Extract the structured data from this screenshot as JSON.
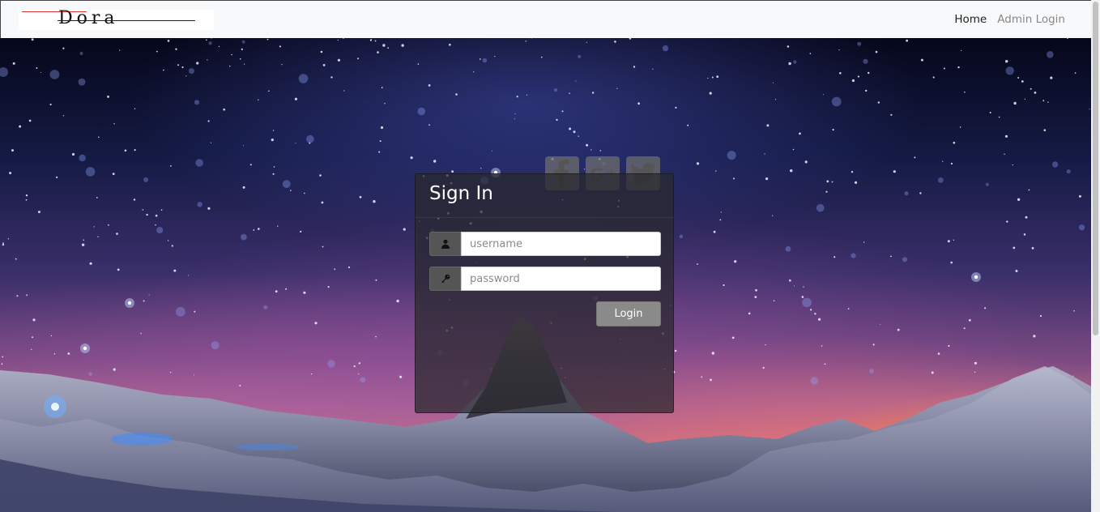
{
  "navbar": {
    "brand_text": "Dora",
    "brand_tagline": "~~~~~~~~~~~~~~~~~~~",
    "links": [
      {
        "label": "Home",
        "active": true
      },
      {
        "label": "Admin Login",
        "active": false
      }
    ]
  },
  "social": [
    {
      "name": "facebook",
      "icon": "facebook-icon"
    },
    {
      "name": "google-plus",
      "icon": "google-plus-icon"
    },
    {
      "name": "twitter",
      "icon": "twitter-icon"
    }
  ],
  "login": {
    "title": "Sign In",
    "username_placeholder": "username",
    "password_placeholder": "password",
    "username_value": "",
    "password_value": "",
    "button_label": "Login",
    "username_icon": "user-icon",
    "password_icon": "key-icon"
  },
  "colors": {
    "panel_bg": "#2a2a2e",
    "button_bg": "#8a8a8a",
    "addon_bg": "#555555",
    "navbar_bg": "#f8f9fa"
  }
}
